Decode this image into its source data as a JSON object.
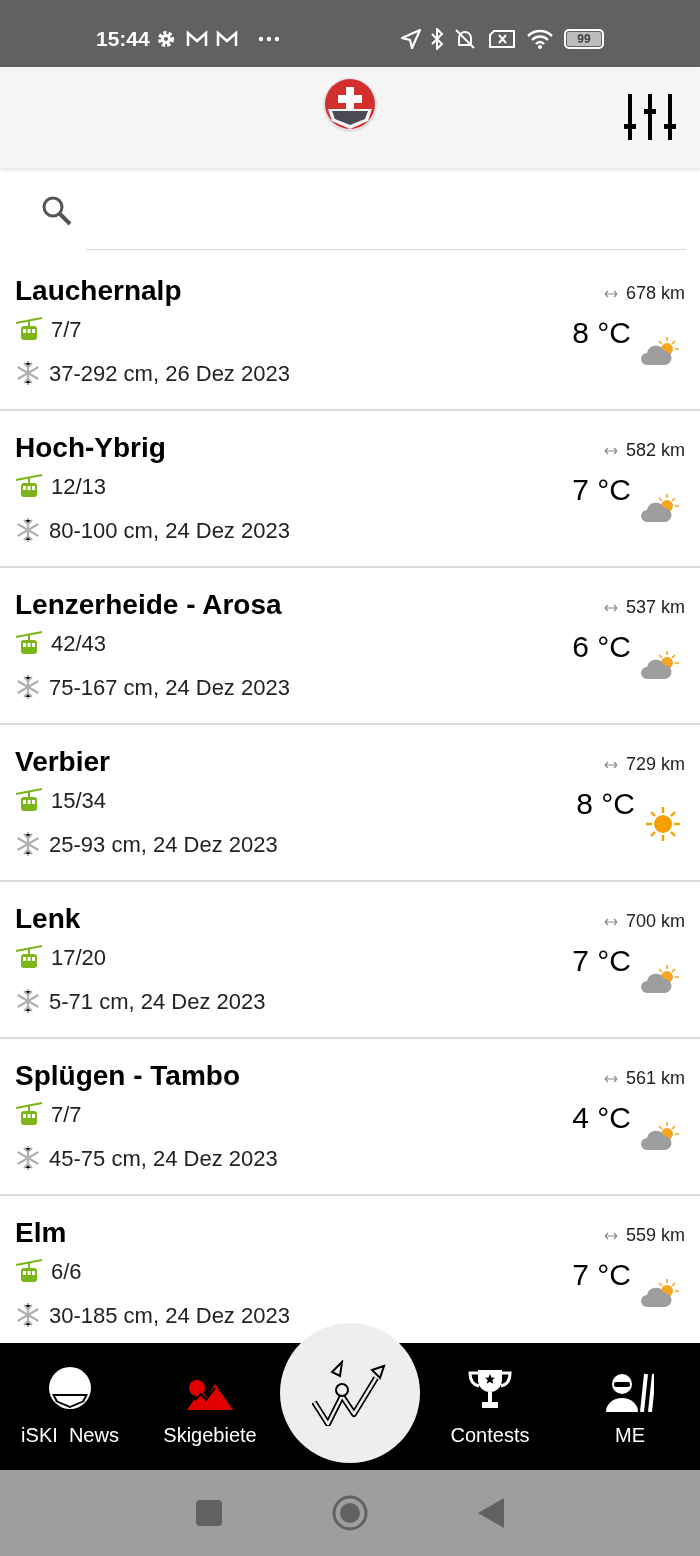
{
  "status_bar": {
    "time": "15:44",
    "battery": "99"
  },
  "resorts": [
    {
      "name": "Lauchernalp",
      "lifts": "7/7",
      "snow": "37-292 cm, 26 Dez 2023",
      "distance": "678 km",
      "temperature": "8 °C",
      "kind": "partly_cloudy"
    },
    {
      "name": "Hoch-Ybrig",
      "lifts": "12/13",
      "snow": "80-100 cm, 24 Dez 2023",
      "distance": "582 km",
      "temperature": "7 °C",
      "kind": "partly_cloudy"
    },
    {
      "name": "Lenzerheide - Arosa",
      "lifts": "42/43",
      "snow": "75-167 cm, 24 Dez 2023",
      "distance": "537 km",
      "temperature": "6 °C",
      "kind": "partly_cloudy"
    },
    {
      "name": "Verbier",
      "lifts": "15/34",
      "snow": "25-93 cm, 24 Dez 2023",
      "distance": "729 km",
      "temperature": "8 °C",
      "kind": "sunny"
    },
    {
      "name": "Lenk",
      "lifts": "17/20",
      "snow": "5-71 cm, 24 Dez 2023",
      "distance": "700 km",
      "temperature": "7 °C",
      "kind": "partly_cloudy"
    },
    {
      "name": "Splügen - Tambo",
      "lifts": "7/7",
      "snow": "45-75 cm, 24 Dez 2023",
      "distance": "561 km",
      "temperature": "4 °C",
      "kind": "partly_cloudy"
    },
    {
      "name": "Elm",
      "lifts": "6/6",
      "snow": "30-185 cm, 24 Dez 2023",
      "distance": "559 km",
      "temperature": "7 °C",
      "kind": "partly_cloudy"
    }
  ],
  "bottom_nav": [
    {
      "label": "iSKI  News",
      "kind": "helmet",
      "selected": false
    },
    {
      "label": "Skigebiete",
      "kind": "mountain",
      "selected": true
    },
    {
      "kind": "center",
      "selected": false
    },
    {
      "label": "Contests",
      "kind": "trophy",
      "selected": false
    },
    {
      "label": "ME",
      "kind": "skier",
      "selected": false
    }
  ]
}
